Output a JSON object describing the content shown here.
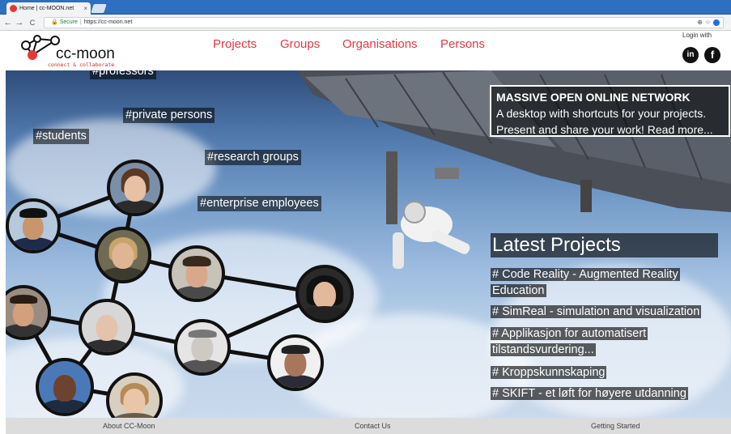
{
  "browser": {
    "tab_title": "Home | cc-MOON.net",
    "close_glyph": "×",
    "back_glyph": "←",
    "forward_glyph": "→",
    "reload_glyph": "C",
    "secure_label": "Secure",
    "url": "https://cc-moon.net",
    "zoom_glyph": "⊕",
    "star_glyph": "☆"
  },
  "header": {
    "logo_text": "cc-moon",
    "logo_tagline": "connect & collaborate",
    "nav": [
      "Projects",
      "Groups",
      "Organisations",
      "Persons"
    ],
    "login_label": "Login with",
    "linkedin_label": "in",
    "facebook_label": "f",
    "accent_color": "#e0393e"
  },
  "hero": {
    "hashtags": [
      "#professors",
      "#private persons",
      "#students",
      "#research groups",
      "#enterprise employees"
    ],
    "massive": {
      "title": "MASSIVE OPEN ONLINE NETWORK",
      "line1": "A desktop with shortcuts for your projects.",
      "line2": "Present and share your work! Read more..."
    },
    "latest_title": "Latest Projects",
    "projects": [
      "# Code Reality - Augmented Reality Education",
      "# SimReal - simulation and visualization",
      "# Applikasjon for automatisert tilstandsvurdering...",
      "# Kroppskunnskaping",
      "# SKIFT - et løft for høyere utdanning"
    ]
  },
  "footer": {
    "links": [
      "About CC-Moon",
      "Contact Us",
      "Getting Started"
    ]
  }
}
